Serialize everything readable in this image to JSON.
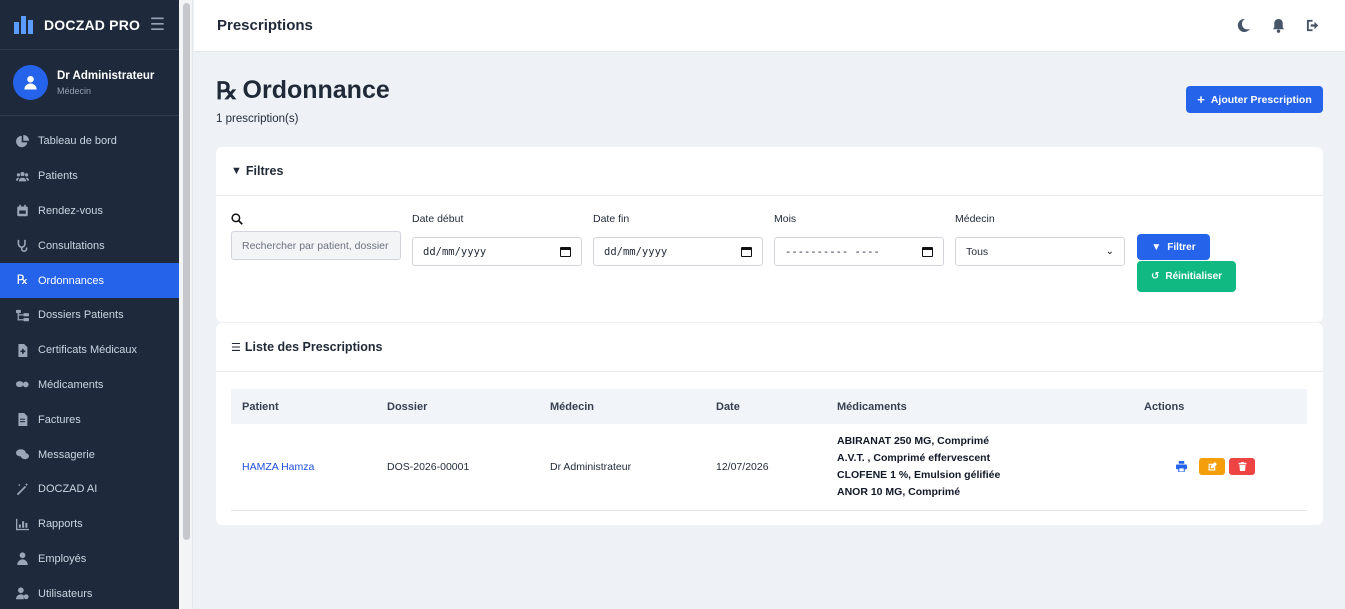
{
  "brand": {
    "name": "DOCZAD PRO"
  },
  "user": {
    "name": "Dr Administrateur",
    "role": "Médecin"
  },
  "sidebar": {
    "items": [
      {
        "label": "Tableau de bord",
        "icon": "chart-pie-icon"
      },
      {
        "label": "Patients",
        "icon": "users-icon"
      },
      {
        "label": "Rendez-vous",
        "icon": "calendar-icon"
      },
      {
        "label": "Consultations",
        "icon": "stethoscope-icon"
      },
      {
        "label": "Ordonnances",
        "icon": "prescription-icon",
        "active": true
      },
      {
        "label": "Dossiers Patients",
        "icon": "folder-tree-icon"
      },
      {
        "label": "Certificats Médicaux",
        "icon": "file-medical-icon"
      },
      {
        "label": "Médicaments",
        "icon": "pills-icon"
      },
      {
        "label": "Factures",
        "icon": "invoice-icon"
      },
      {
        "label": "Messagerie",
        "icon": "comments-icon"
      },
      {
        "label": "DOCZAD AI",
        "icon": "magic-wand-icon"
      },
      {
        "label": "Rapports",
        "icon": "bar-chart-icon"
      },
      {
        "label": "Employés",
        "icon": "user-tie-icon"
      },
      {
        "label": "Utilisateurs",
        "icon": "user-cog-icon"
      }
    ]
  },
  "topbar": {
    "title": "Prescriptions"
  },
  "page": {
    "title": "Ordonnance",
    "subtitle": "1 prescription(s)",
    "add_button": "Ajouter Prescription"
  },
  "filters": {
    "header": "Filtres",
    "search_placeholder": "Rechercher par patient, dossier",
    "date_start_label": "Date début",
    "date_start_value": "dd/mm/yyyy",
    "date_end_label": "Date fin",
    "date_end_value": "dd/mm/yyyy",
    "month_label": "Mois",
    "month_value": "---------- ----",
    "doctor_label": "Médecin",
    "doctor_value": "Tous",
    "filter_button": "Filtrer",
    "reset_button": "Réinitialiser"
  },
  "list": {
    "header": "Liste des Prescriptions",
    "columns": {
      "patient": "Patient",
      "dossier": "Dossier",
      "medecin": "Médecin",
      "date": "Date",
      "medicaments": "Médicaments",
      "actions": "Actions"
    },
    "rows": [
      {
        "patient": "HAMZA Hamza",
        "dossier": "DOS-2026-00001",
        "medecin": "Dr Administrateur",
        "date": "12/07/2026",
        "medicaments": [
          "ABIRANAT 250 MG, Comprimé",
          "A.V.T. , Comprimé effervescent",
          "CLOFENE 1 %, Emulsion gélifiée",
          "ANOR 10 MG, Comprimé"
        ]
      }
    ]
  },
  "colors": {
    "sidebar_bg": "#1e2a3b",
    "primary": "#2563eb",
    "success": "#10b981",
    "warning": "#f59e0b",
    "danger": "#ef4444"
  }
}
